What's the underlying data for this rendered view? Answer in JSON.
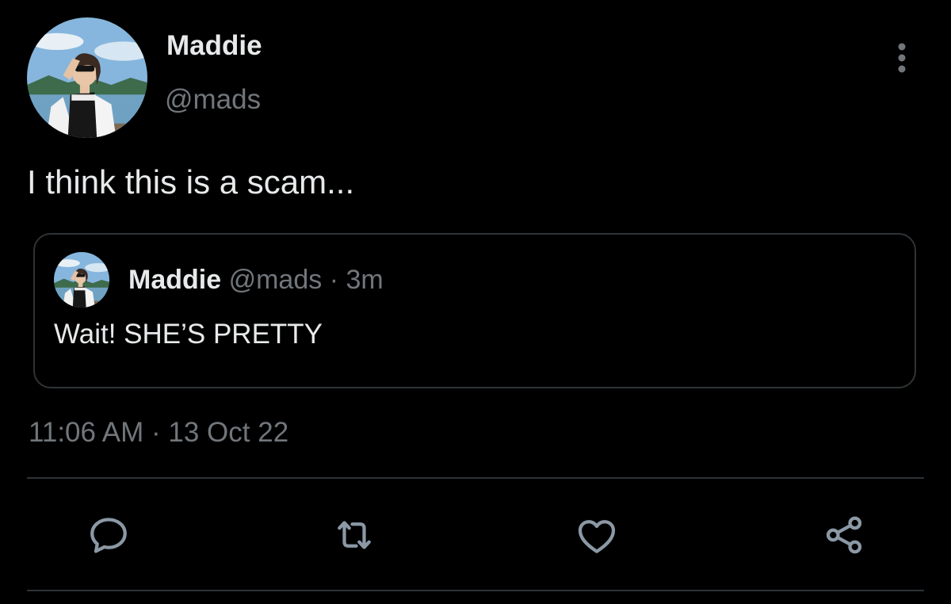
{
  "tweet": {
    "author": {
      "name": "Maddie",
      "handle": "@mads"
    },
    "text": "I think this is a scam...",
    "timestamp": {
      "time": "11:06 AM",
      "separator": "·",
      "date": "13 Oct 22"
    }
  },
  "quoted_tweet": {
    "author": {
      "name": "Maddie",
      "handle": "@mads"
    },
    "separator": "·",
    "age": "3m",
    "text": "Wait! SHE’S PRETTY"
  },
  "actions": [
    "reply-icon",
    "retweet-icon",
    "like-icon",
    "share-icon"
  ],
  "icons": {
    "more": "more-vertical-icon"
  },
  "colors": {
    "background": "#000000",
    "primary_text": "#e7e9ea",
    "secondary_text": "#71767b",
    "border": "#2f3336",
    "icon": "#8b98a5"
  }
}
